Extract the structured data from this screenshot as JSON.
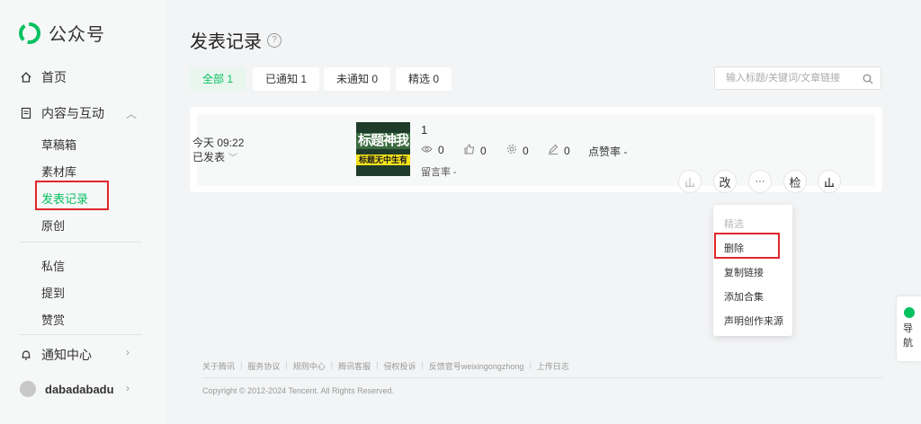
{
  "brand": {
    "name": "公众号",
    "color": "#07c160"
  },
  "sidebar": {
    "home": {
      "label": "首页",
      "icon": "home-icon"
    },
    "content": {
      "label": "内容与互动",
      "icon": "document-icon"
    },
    "content_items": [
      {
        "label": "草稿箱"
      },
      {
        "label": "素材库"
      },
      {
        "label": "发表记录",
        "active": true
      },
      {
        "label": "原创"
      }
    ],
    "interact_items": [
      {
        "label": "私信"
      },
      {
        "label": "提到"
      },
      {
        "label": "赞赏"
      }
    ],
    "notify": {
      "label": "通知中心",
      "icon": "bell-icon"
    },
    "user": {
      "name": "dabadabadu"
    }
  },
  "header": {
    "title": "发表记录",
    "help_icon": "help-icon"
  },
  "filters": [
    {
      "label": "全部 1",
      "active": true
    },
    {
      "label": "已通知 1"
    },
    {
      "label": "未通知 0"
    },
    {
      "label": "精选 0"
    }
  ],
  "search": {
    "placeholder": "输入标题/关键词/文章链接"
  },
  "article": {
    "time": "今天 09:22",
    "status": "已发表",
    "thumb_text_1": "标题神我",
    "thumb_text_2": "标题无中生有",
    "title": "1",
    "stats": {
      "reads": "0",
      "likes": "0",
      "shares": "0",
      "comments": "0"
    },
    "stat_label": "点赞率 -",
    "extra": "留言率 -",
    "buttons": {
      "edit": "改",
      "more": "···",
      "check": "检"
    }
  },
  "dropdown": [
    "精选",
    "删除",
    "复制链接",
    "添加合集",
    "声明创作来源"
  ],
  "footer": {
    "links": [
      "关于腾讯",
      "服务协议",
      "规则中心",
      "腾讯客服",
      "侵权投诉",
      "反馈官号weixingongzhong",
      "上传日志"
    ],
    "copyright": "Copyright © 2012-2024 Tencent. All Rights Reserved."
  },
  "float_nav": {
    "label": "导航"
  },
  "colors": {
    "accent": "#07c160",
    "highlight": "#e0262c"
  }
}
